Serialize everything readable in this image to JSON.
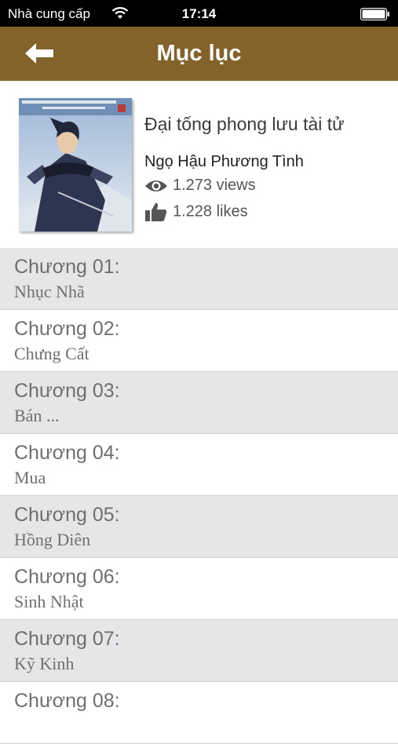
{
  "status_bar": {
    "carrier": "Nhà cung cấp",
    "time": "17:14"
  },
  "nav": {
    "title": "Mục lục",
    "back_icon": "arrow-left-icon"
  },
  "book": {
    "title": "Đại tống phong lưu tài tử",
    "author": "Ngọ Hậu Phương Tình",
    "views": "1.273 views",
    "likes": "1.228 likes"
  },
  "chapters": [
    {
      "number": "Chương 01:",
      "name": "Nhục Nhã"
    },
    {
      "number": "Chương 02:",
      "name": "Chưng Cất"
    },
    {
      "number": "Chương 03:",
      "name": "Bán ..."
    },
    {
      "number": "Chương 04:",
      "name": "Mua"
    },
    {
      "number": "Chương 05:",
      "name": "Hồng Diên"
    },
    {
      "number": "Chương 06:",
      "name": "Sinh Nhật"
    },
    {
      "number": "Chương 07:",
      "name": "Kỹ Kinh"
    },
    {
      "number": "Chương 08:",
      "name": ""
    }
  ],
  "colors": {
    "nav_background": "#84632b",
    "row_alt": "#e6e6e8",
    "row_text": "#6f6f6f"
  }
}
